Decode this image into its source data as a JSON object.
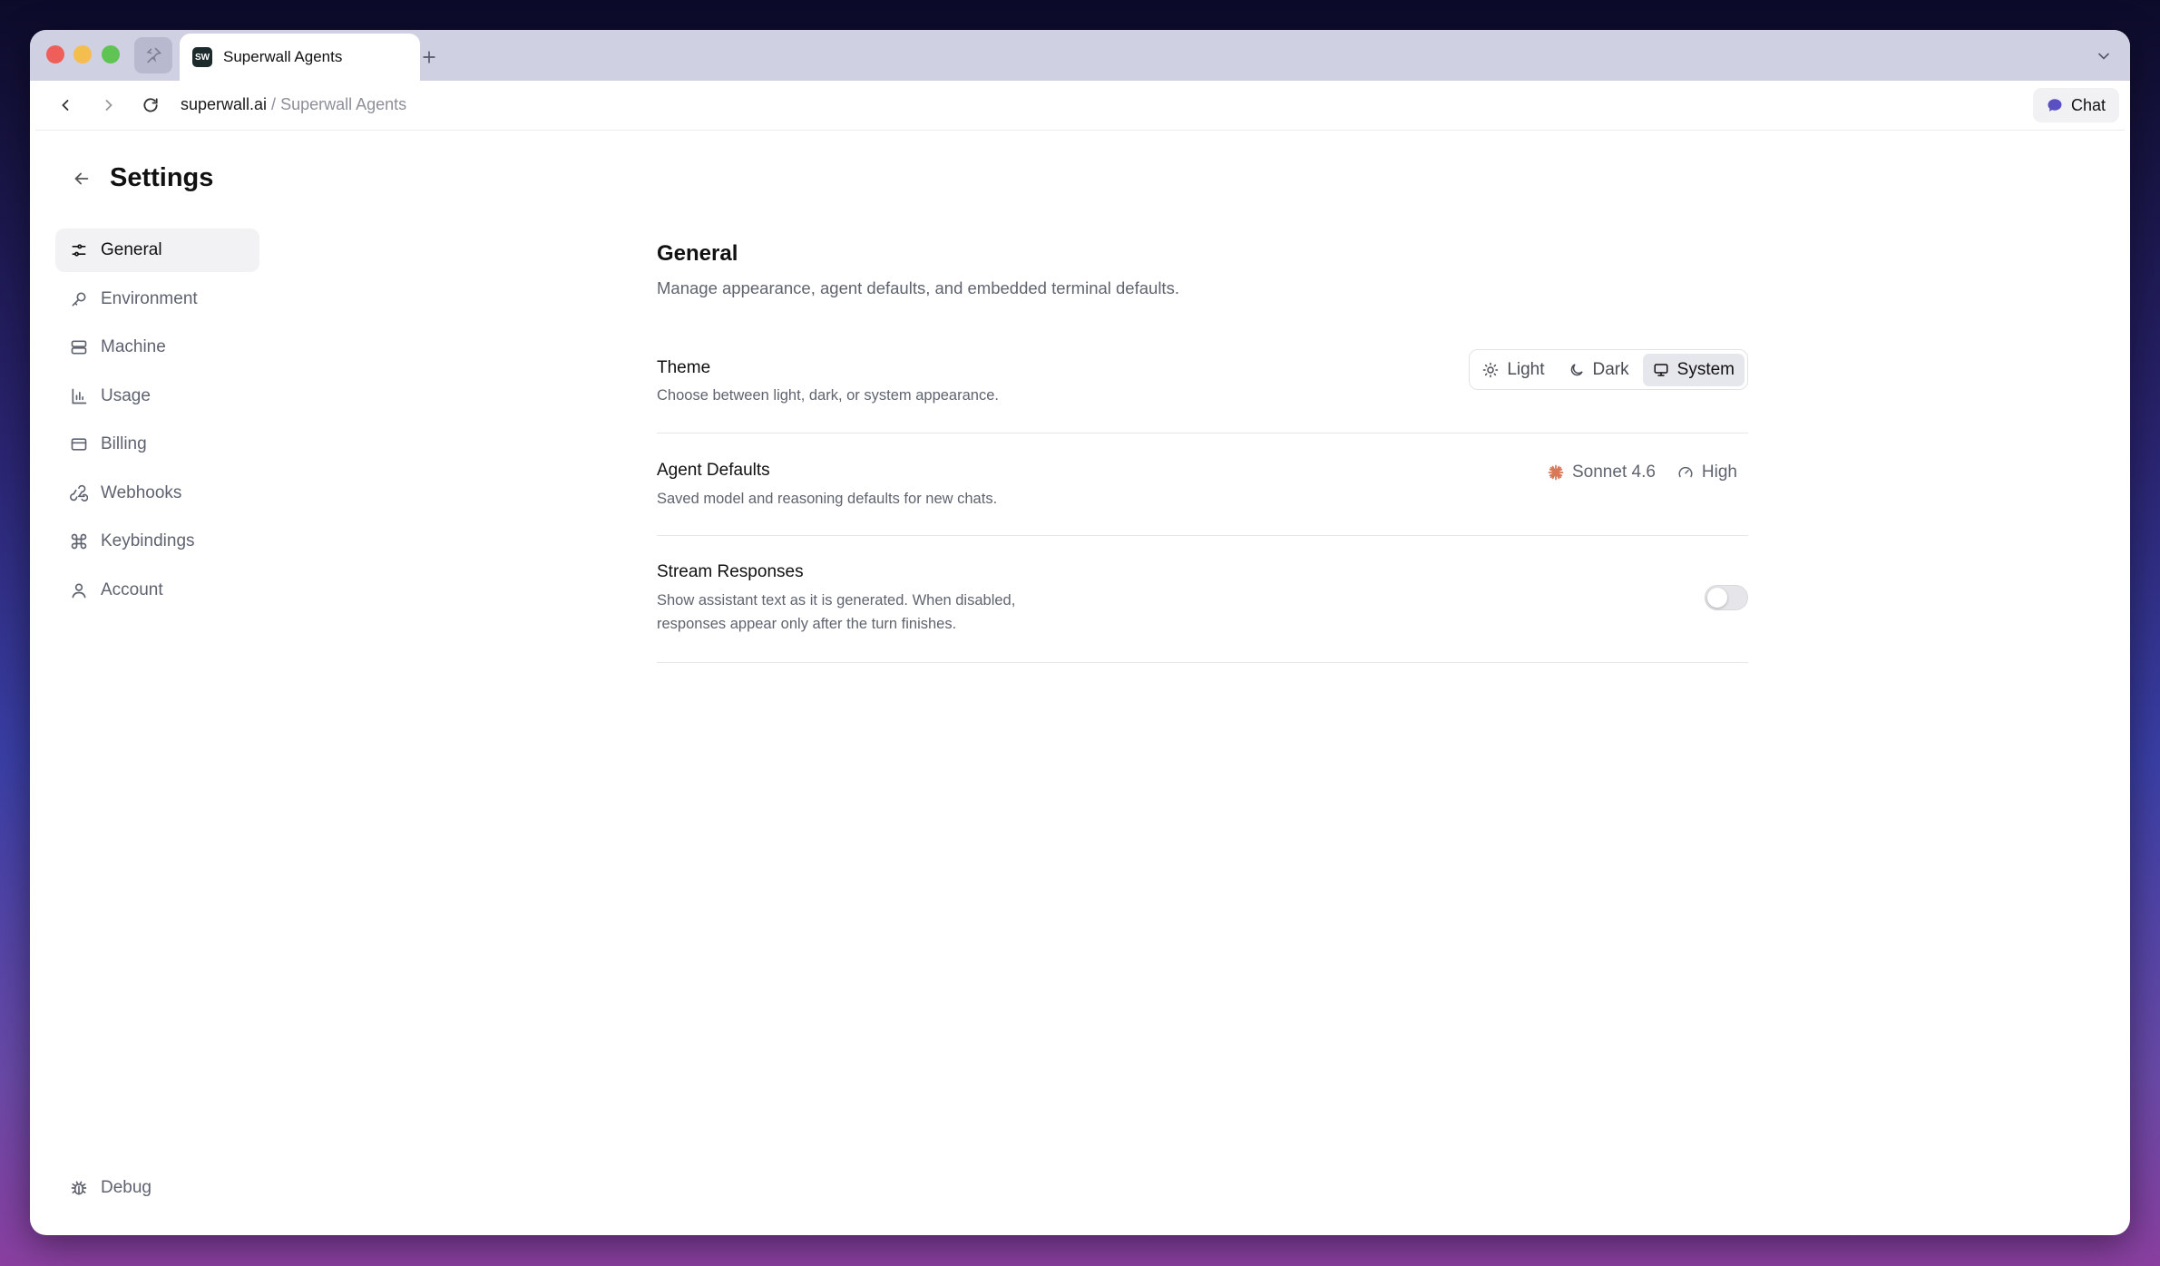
{
  "browser": {
    "tab_title": "Superwall Agents",
    "favicon_text": "SW",
    "url_domain": "superwall.ai",
    "url_separator": " / ",
    "url_page": "Superwall Agents",
    "chat_label": "Chat"
  },
  "settings": {
    "title": "Settings"
  },
  "sidebar": {
    "items": [
      {
        "label": "General",
        "icon": "sliders-icon",
        "active": true
      },
      {
        "label": "Environment",
        "icon": "key-icon"
      },
      {
        "label": "Machine",
        "icon": "server-icon"
      },
      {
        "label": "Usage",
        "icon": "bar-chart-icon"
      },
      {
        "label": "Billing",
        "icon": "credit-card-icon"
      },
      {
        "label": "Webhooks",
        "icon": "webhook-icon"
      },
      {
        "label": "Keybindings",
        "icon": "command-icon"
      },
      {
        "label": "Account",
        "icon": "user-icon"
      }
    ],
    "debug_label": "Debug"
  },
  "general": {
    "title": "General",
    "description": "Manage appearance, agent defaults, and embedded terminal defaults.",
    "theme": {
      "label": "Theme",
      "description": "Choose between light, dark, or system appearance.",
      "options": [
        "Light",
        "Dark",
        "System"
      ],
      "selected": "System"
    },
    "agent_defaults": {
      "label": "Agent Defaults",
      "description": "Saved model and reasoning defaults for new chats.",
      "model": "Sonnet 4.6",
      "reasoning": "High",
      "model_icon_color": "#d97757"
    },
    "stream_responses": {
      "label": "Stream Responses",
      "description_line1": "Show assistant text as it is generated. When disabled,",
      "description_line2": "responses appear only after the turn finishes.",
      "enabled": false
    }
  }
}
